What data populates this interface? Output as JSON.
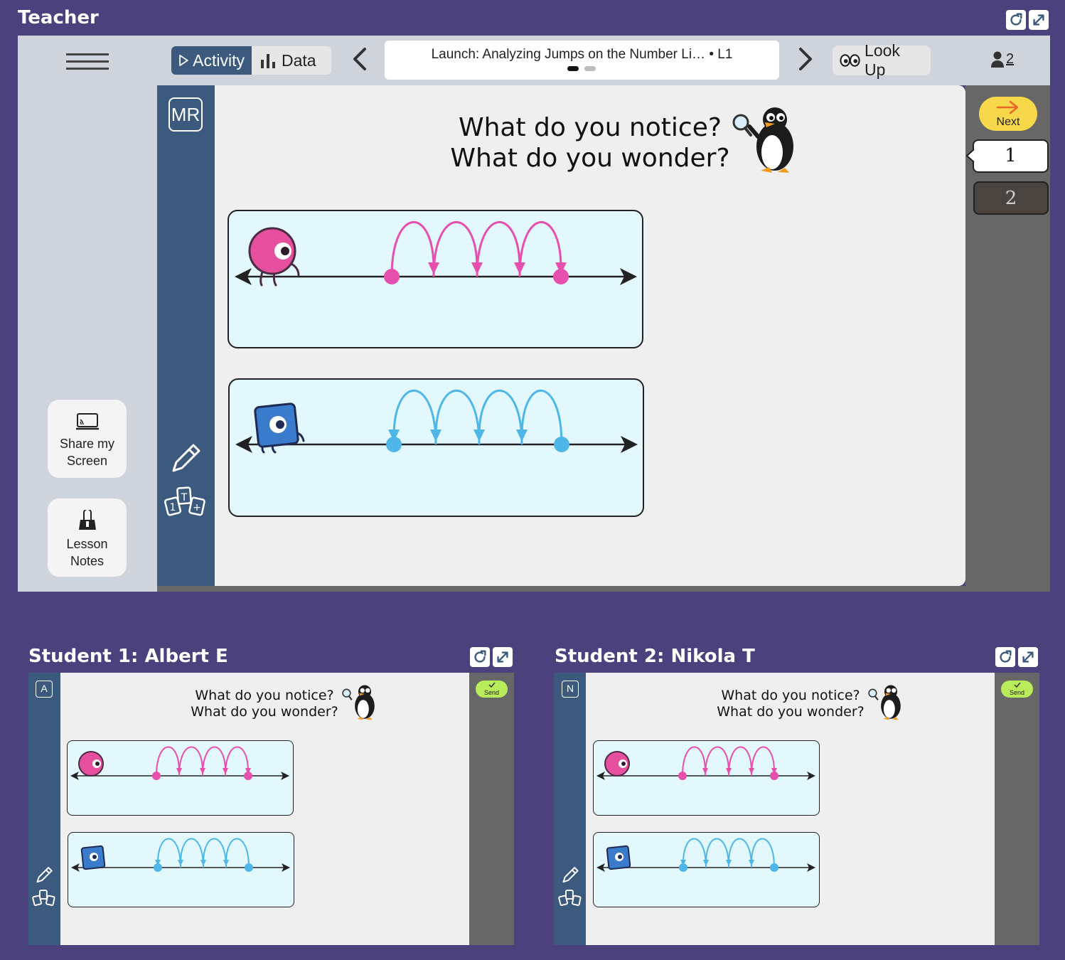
{
  "teacher": {
    "title": "Teacher",
    "toolbar": {
      "activity_label": "Activity",
      "data_label": "Data",
      "lesson_title": "Launch: Analyzing Jumps on the Number Li…",
      "lesson_suffix": "• L1",
      "lookup_label": "Look Up",
      "participant_count": "2"
    },
    "rail": {
      "initials": "MR"
    },
    "side": {
      "share_line1": "Share my",
      "share_line2": "Screen",
      "notes_line1": "Lesson",
      "notes_line2": "Notes"
    },
    "right": {
      "next_label": "Next",
      "page1": "1",
      "page2": "2"
    },
    "question": {
      "line1": "What do you notice?",
      "line2": "What do you wonder?"
    }
  },
  "students": [
    {
      "title": "Student 1: Albert E",
      "initial": "A",
      "send_label": "Send"
    },
    {
      "title": "Student 2: Nikola T",
      "initial": "N",
      "send_label": "Send"
    }
  ],
  "colors": {
    "background": "#4b417c",
    "rail": "#3b5a7e",
    "pink": "#e64fae",
    "blue": "#4fb7e8",
    "next_yellow": "#f6d84a",
    "send_green": "#b8ec5a"
  }
}
